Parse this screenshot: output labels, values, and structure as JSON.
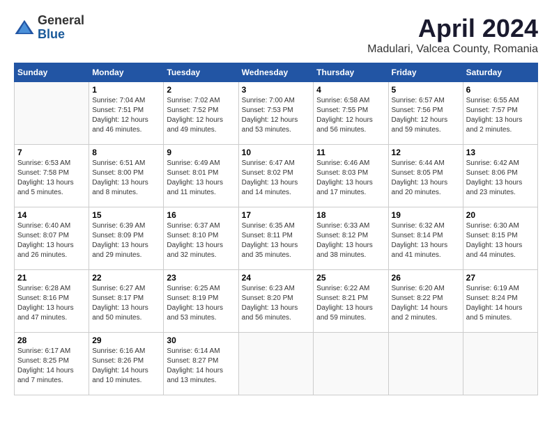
{
  "logo": {
    "general": "General",
    "blue": "Blue"
  },
  "title": "April 2024",
  "location": "Madulari, Valcea County, Romania",
  "days_of_week": [
    "Sunday",
    "Monday",
    "Tuesday",
    "Wednesday",
    "Thursday",
    "Friday",
    "Saturday"
  ],
  "weeks": [
    [
      {
        "day": "",
        "sunrise": "",
        "sunset": "",
        "daylight": ""
      },
      {
        "day": "1",
        "sunrise": "Sunrise: 7:04 AM",
        "sunset": "Sunset: 7:51 PM",
        "daylight": "Daylight: 12 hours and 46 minutes."
      },
      {
        "day": "2",
        "sunrise": "Sunrise: 7:02 AM",
        "sunset": "Sunset: 7:52 PM",
        "daylight": "Daylight: 12 hours and 49 minutes."
      },
      {
        "day": "3",
        "sunrise": "Sunrise: 7:00 AM",
        "sunset": "Sunset: 7:53 PM",
        "daylight": "Daylight: 12 hours and 53 minutes."
      },
      {
        "day": "4",
        "sunrise": "Sunrise: 6:58 AM",
        "sunset": "Sunset: 7:55 PM",
        "daylight": "Daylight: 12 hours and 56 minutes."
      },
      {
        "day": "5",
        "sunrise": "Sunrise: 6:57 AM",
        "sunset": "Sunset: 7:56 PM",
        "daylight": "Daylight: 12 hours and 59 minutes."
      },
      {
        "day": "6",
        "sunrise": "Sunrise: 6:55 AM",
        "sunset": "Sunset: 7:57 PM",
        "daylight": "Daylight: 13 hours and 2 minutes."
      }
    ],
    [
      {
        "day": "7",
        "sunrise": "Sunrise: 6:53 AM",
        "sunset": "Sunset: 7:58 PM",
        "daylight": "Daylight: 13 hours and 5 minutes."
      },
      {
        "day": "8",
        "sunrise": "Sunrise: 6:51 AM",
        "sunset": "Sunset: 8:00 PM",
        "daylight": "Daylight: 13 hours and 8 minutes."
      },
      {
        "day": "9",
        "sunrise": "Sunrise: 6:49 AM",
        "sunset": "Sunset: 8:01 PM",
        "daylight": "Daylight: 13 hours and 11 minutes."
      },
      {
        "day": "10",
        "sunrise": "Sunrise: 6:47 AM",
        "sunset": "Sunset: 8:02 PM",
        "daylight": "Daylight: 13 hours and 14 minutes."
      },
      {
        "day": "11",
        "sunrise": "Sunrise: 6:46 AM",
        "sunset": "Sunset: 8:03 PM",
        "daylight": "Daylight: 13 hours and 17 minutes."
      },
      {
        "day": "12",
        "sunrise": "Sunrise: 6:44 AM",
        "sunset": "Sunset: 8:05 PM",
        "daylight": "Daylight: 13 hours and 20 minutes."
      },
      {
        "day": "13",
        "sunrise": "Sunrise: 6:42 AM",
        "sunset": "Sunset: 8:06 PM",
        "daylight": "Daylight: 13 hours and 23 minutes."
      }
    ],
    [
      {
        "day": "14",
        "sunrise": "Sunrise: 6:40 AM",
        "sunset": "Sunset: 8:07 PM",
        "daylight": "Daylight: 13 hours and 26 minutes."
      },
      {
        "day": "15",
        "sunrise": "Sunrise: 6:39 AM",
        "sunset": "Sunset: 8:09 PM",
        "daylight": "Daylight: 13 hours and 29 minutes."
      },
      {
        "day": "16",
        "sunrise": "Sunrise: 6:37 AM",
        "sunset": "Sunset: 8:10 PM",
        "daylight": "Daylight: 13 hours and 32 minutes."
      },
      {
        "day": "17",
        "sunrise": "Sunrise: 6:35 AM",
        "sunset": "Sunset: 8:11 PM",
        "daylight": "Daylight: 13 hours and 35 minutes."
      },
      {
        "day": "18",
        "sunrise": "Sunrise: 6:33 AM",
        "sunset": "Sunset: 8:12 PM",
        "daylight": "Daylight: 13 hours and 38 minutes."
      },
      {
        "day": "19",
        "sunrise": "Sunrise: 6:32 AM",
        "sunset": "Sunset: 8:14 PM",
        "daylight": "Daylight: 13 hours and 41 minutes."
      },
      {
        "day": "20",
        "sunrise": "Sunrise: 6:30 AM",
        "sunset": "Sunset: 8:15 PM",
        "daylight": "Daylight: 13 hours and 44 minutes."
      }
    ],
    [
      {
        "day": "21",
        "sunrise": "Sunrise: 6:28 AM",
        "sunset": "Sunset: 8:16 PM",
        "daylight": "Daylight: 13 hours and 47 minutes."
      },
      {
        "day": "22",
        "sunrise": "Sunrise: 6:27 AM",
        "sunset": "Sunset: 8:17 PM",
        "daylight": "Daylight: 13 hours and 50 minutes."
      },
      {
        "day": "23",
        "sunrise": "Sunrise: 6:25 AM",
        "sunset": "Sunset: 8:19 PM",
        "daylight": "Daylight: 13 hours and 53 minutes."
      },
      {
        "day": "24",
        "sunrise": "Sunrise: 6:23 AM",
        "sunset": "Sunset: 8:20 PM",
        "daylight": "Daylight: 13 hours and 56 minutes."
      },
      {
        "day": "25",
        "sunrise": "Sunrise: 6:22 AM",
        "sunset": "Sunset: 8:21 PM",
        "daylight": "Daylight: 13 hours and 59 minutes."
      },
      {
        "day": "26",
        "sunrise": "Sunrise: 6:20 AM",
        "sunset": "Sunset: 8:22 PM",
        "daylight": "Daylight: 14 hours and 2 minutes."
      },
      {
        "day": "27",
        "sunrise": "Sunrise: 6:19 AM",
        "sunset": "Sunset: 8:24 PM",
        "daylight": "Daylight: 14 hours and 5 minutes."
      }
    ],
    [
      {
        "day": "28",
        "sunrise": "Sunrise: 6:17 AM",
        "sunset": "Sunset: 8:25 PM",
        "daylight": "Daylight: 14 hours and 7 minutes."
      },
      {
        "day": "29",
        "sunrise": "Sunrise: 6:16 AM",
        "sunset": "Sunset: 8:26 PM",
        "daylight": "Daylight: 14 hours and 10 minutes."
      },
      {
        "day": "30",
        "sunrise": "Sunrise: 6:14 AM",
        "sunset": "Sunset: 8:27 PM",
        "daylight": "Daylight: 14 hours and 13 minutes."
      },
      {
        "day": "",
        "sunrise": "",
        "sunset": "",
        "daylight": ""
      },
      {
        "day": "",
        "sunrise": "",
        "sunset": "",
        "daylight": ""
      },
      {
        "day": "",
        "sunrise": "",
        "sunset": "",
        "daylight": ""
      },
      {
        "day": "",
        "sunrise": "",
        "sunset": "",
        "daylight": ""
      }
    ]
  ]
}
